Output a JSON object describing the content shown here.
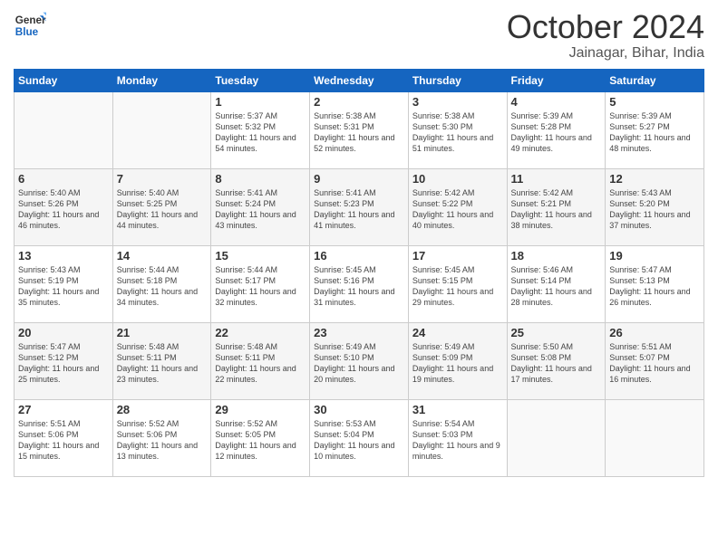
{
  "logo": {
    "line1": "General",
    "line2": "Blue"
  },
  "header": {
    "month": "October 2024",
    "location": "Jainagar, Bihar, India"
  },
  "days_of_week": [
    "Sunday",
    "Monday",
    "Tuesday",
    "Wednesday",
    "Thursday",
    "Friday",
    "Saturday"
  ],
  "weeks": [
    [
      {
        "day": "",
        "content": ""
      },
      {
        "day": "",
        "content": ""
      },
      {
        "day": "1",
        "sunrise": "Sunrise: 5:37 AM",
        "sunset": "Sunset: 5:32 PM",
        "daylight": "Daylight: 11 hours and 54 minutes."
      },
      {
        "day": "2",
        "sunrise": "Sunrise: 5:38 AM",
        "sunset": "Sunset: 5:31 PM",
        "daylight": "Daylight: 11 hours and 52 minutes."
      },
      {
        "day": "3",
        "sunrise": "Sunrise: 5:38 AM",
        "sunset": "Sunset: 5:30 PM",
        "daylight": "Daylight: 11 hours and 51 minutes."
      },
      {
        "day": "4",
        "sunrise": "Sunrise: 5:39 AM",
        "sunset": "Sunset: 5:28 PM",
        "daylight": "Daylight: 11 hours and 49 minutes."
      },
      {
        "day": "5",
        "sunrise": "Sunrise: 5:39 AM",
        "sunset": "Sunset: 5:27 PM",
        "daylight": "Daylight: 11 hours and 48 minutes."
      }
    ],
    [
      {
        "day": "6",
        "sunrise": "Sunrise: 5:40 AM",
        "sunset": "Sunset: 5:26 PM",
        "daylight": "Daylight: 11 hours and 46 minutes."
      },
      {
        "day": "7",
        "sunrise": "Sunrise: 5:40 AM",
        "sunset": "Sunset: 5:25 PM",
        "daylight": "Daylight: 11 hours and 44 minutes."
      },
      {
        "day": "8",
        "sunrise": "Sunrise: 5:41 AM",
        "sunset": "Sunset: 5:24 PM",
        "daylight": "Daylight: 11 hours and 43 minutes."
      },
      {
        "day": "9",
        "sunrise": "Sunrise: 5:41 AM",
        "sunset": "Sunset: 5:23 PM",
        "daylight": "Daylight: 11 hours and 41 minutes."
      },
      {
        "day": "10",
        "sunrise": "Sunrise: 5:42 AM",
        "sunset": "Sunset: 5:22 PM",
        "daylight": "Daylight: 11 hours and 40 minutes."
      },
      {
        "day": "11",
        "sunrise": "Sunrise: 5:42 AM",
        "sunset": "Sunset: 5:21 PM",
        "daylight": "Daylight: 11 hours and 38 minutes."
      },
      {
        "day": "12",
        "sunrise": "Sunrise: 5:43 AM",
        "sunset": "Sunset: 5:20 PM",
        "daylight": "Daylight: 11 hours and 37 minutes."
      }
    ],
    [
      {
        "day": "13",
        "sunrise": "Sunrise: 5:43 AM",
        "sunset": "Sunset: 5:19 PM",
        "daylight": "Daylight: 11 hours and 35 minutes."
      },
      {
        "day": "14",
        "sunrise": "Sunrise: 5:44 AM",
        "sunset": "Sunset: 5:18 PM",
        "daylight": "Daylight: 11 hours and 34 minutes."
      },
      {
        "day": "15",
        "sunrise": "Sunrise: 5:44 AM",
        "sunset": "Sunset: 5:17 PM",
        "daylight": "Daylight: 11 hours and 32 minutes."
      },
      {
        "day": "16",
        "sunrise": "Sunrise: 5:45 AM",
        "sunset": "Sunset: 5:16 PM",
        "daylight": "Daylight: 11 hours and 31 minutes."
      },
      {
        "day": "17",
        "sunrise": "Sunrise: 5:45 AM",
        "sunset": "Sunset: 5:15 PM",
        "daylight": "Daylight: 11 hours and 29 minutes."
      },
      {
        "day": "18",
        "sunrise": "Sunrise: 5:46 AM",
        "sunset": "Sunset: 5:14 PM",
        "daylight": "Daylight: 11 hours and 28 minutes."
      },
      {
        "day": "19",
        "sunrise": "Sunrise: 5:47 AM",
        "sunset": "Sunset: 5:13 PM",
        "daylight": "Daylight: 11 hours and 26 minutes."
      }
    ],
    [
      {
        "day": "20",
        "sunrise": "Sunrise: 5:47 AM",
        "sunset": "Sunset: 5:12 PM",
        "daylight": "Daylight: 11 hours and 25 minutes."
      },
      {
        "day": "21",
        "sunrise": "Sunrise: 5:48 AM",
        "sunset": "Sunset: 5:11 PM",
        "daylight": "Daylight: 11 hours and 23 minutes."
      },
      {
        "day": "22",
        "sunrise": "Sunrise: 5:48 AM",
        "sunset": "Sunset: 5:11 PM",
        "daylight": "Daylight: 11 hours and 22 minutes."
      },
      {
        "day": "23",
        "sunrise": "Sunrise: 5:49 AM",
        "sunset": "Sunset: 5:10 PM",
        "daylight": "Daylight: 11 hours and 20 minutes."
      },
      {
        "day": "24",
        "sunrise": "Sunrise: 5:49 AM",
        "sunset": "Sunset: 5:09 PM",
        "daylight": "Daylight: 11 hours and 19 minutes."
      },
      {
        "day": "25",
        "sunrise": "Sunrise: 5:50 AM",
        "sunset": "Sunset: 5:08 PM",
        "daylight": "Daylight: 11 hours and 17 minutes."
      },
      {
        "day": "26",
        "sunrise": "Sunrise: 5:51 AM",
        "sunset": "Sunset: 5:07 PM",
        "daylight": "Daylight: 11 hours and 16 minutes."
      }
    ],
    [
      {
        "day": "27",
        "sunrise": "Sunrise: 5:51 AM",
        "sunset": "Sunset: 5:06 PM",
        "daylight": "Daylight: 11 hours and 15 minutes."
      },
      {
        "day": "28",
        "sunrise": "Sunrise: 5:52 AM",
        "sunset": "Sunset: 5:06 PM",
        "daylight": "Daylight: 11 hours and 13 minutes."
      },
      {
        "day": "29",
        "sunrise": "Sunrise: 5:52 AM",
        "sunset": "Sunset: 5:05 PM",
        "daylight": "Daylight: 11 hours and 12 minutes."
      },
      {
        "day": "30",
        "sunrise": "Sunrise: 5:53 AM",
        "sunset": "Sunset: 5:04 PM",
        "daylight": "Daylight: 11 hours and 10 minutes."
      },
      {
        "day": "31",
        "sunrise": "Sunrise: 5:54 AM",
        "sunset": "Sunset: 5:03 PM",
        "daylight": "Daylight: 11 hours and 9 minutes."
      },
      {
        "day": "",
        "content": ""
      },
      {
        "day": "",
        "content": ""
      }
    ]
  ]
}
